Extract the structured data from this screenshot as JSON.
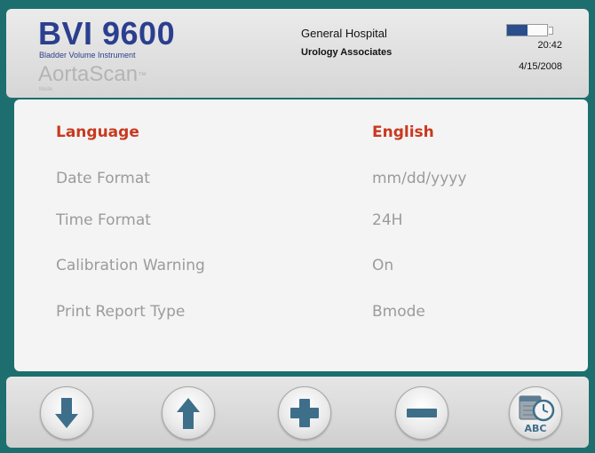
{
  "header": {
    "brand_title": "BVI 9600",
    "brand_subtitle": "Bladder Volume Instrument",
    "mode_name": "AortaScan",
    "mode_trademark": "™",
    "mode_label": "Mode",
    "hospital": "General Hospital",
    "practice": "Urology Associates",
    "time": "20:42",
    "date": "4/15/2008",
    "battery_level": 0.5
  },
  "settings": [
    {
      "label": "Language",
      "value": "English",
      "selected": true
    },
    {
      "label": "Date Format",
      "value": "mm/dd/yyyy",
      "selected": false
    },
    {
      "label": "Time Format",
      "value": "24H",
      "selected": false
    },
    {
      "label": "Calibration Warning",
      "value": "On",
      "selected": false
    },
    {
      "label": "Print Report Type",
      "value": "Bmode",
      "selected": false
    }
  ],
  "footer": {
    "buttons": [
      {
        "name": "down-button",
        "icon": "arrow-down-icon"
      },
      {
        "name": "up-button",
        "icon": "arrow-up-icon"
      },
      {
        "name": "plus-button",
        "icon": "plus-icon"
      },
      {
        "name": "minus-button",
        "icon": "minus-icon"
      },
      {
        "name": "date-time-keyboard-button",
        "icon": "calendar-clock-abc-icon",
        "icon_text": "ABC"
      }
    ]
  },
  "colors": {
    "background": "#1c6f6e",
    "brand": "#2b3f8e",
    "selected": "#c9391f",
    "inactive": "#9b9b9b",
    "button_icon": "#3e6f8a"
  }
}
